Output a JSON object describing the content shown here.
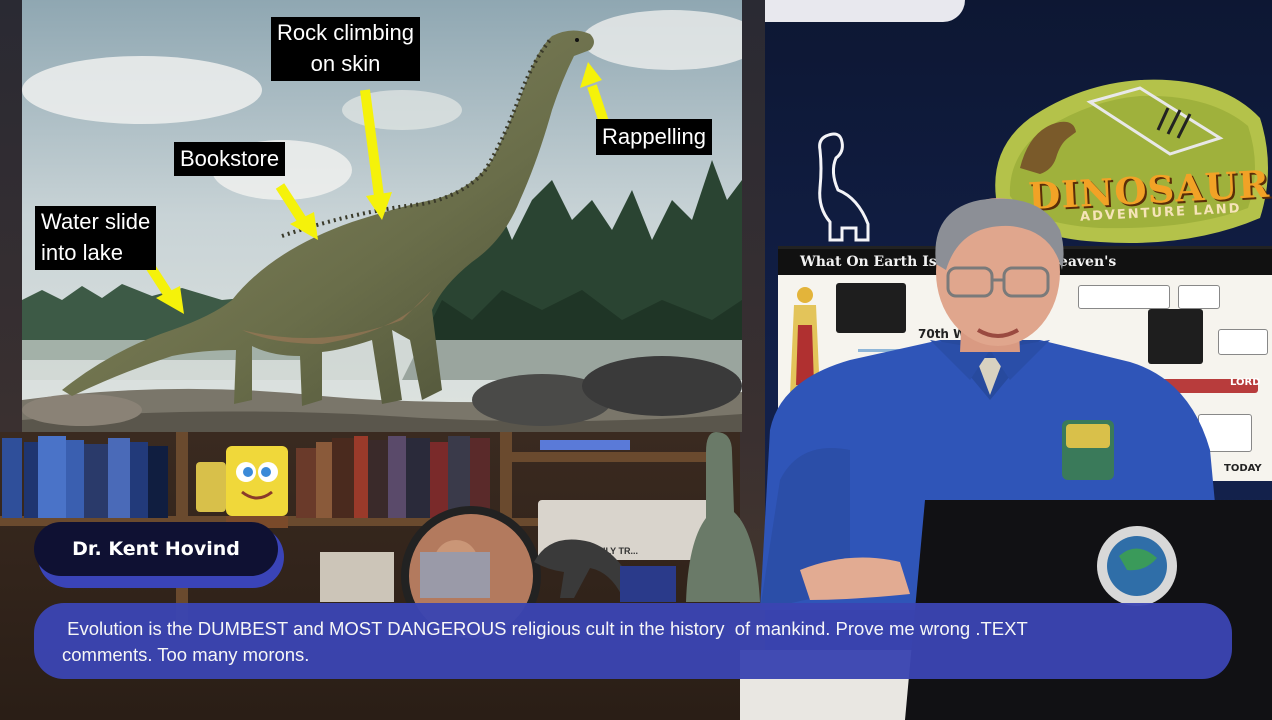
{
  "slide": {
    "callouts": {
      "rock_climbing_line1": "Rock climbing",
      "rock_climbing_line2": "on skin",
      "bookstore": "Bookstore",
      "rappelling": "Rappelling",
      "water_slide_line1": "Water slide",
      "water_slide_line2": "into lake"
    }
  },
  "background": {
    "logo_title": "DINOSAUR",
    "logo_subtitle": "ADVENTURE LAND",
    "chart_header": "What On Earth Is H . . . . . . for Heaven's",
    "chart_label_70th": "70th W",
    "chart_label_lord": "LORD",
    "chart_label_today": "TODAY",
    "shelf_banner": "...IONISM FAMILY TR..."
  },
  "nameplate": {
    "name": "Dr. Kent Hovind"
  },
  "caption": {
    "line1": " Evolution is the DUMBEST and MOST DANGEROUS religious cult in the history  of mankind. Prove me wrong .TEXT",
    "line2": "comments. Too many morons."
  },
  "colors": {
    "caption_bg": "#3b45b2",
    "nameplate_bg": "#0f1133",
    "arrow_yellow": "#f5f20a",
    "logo_orange": "#f2a226"
  }
}
